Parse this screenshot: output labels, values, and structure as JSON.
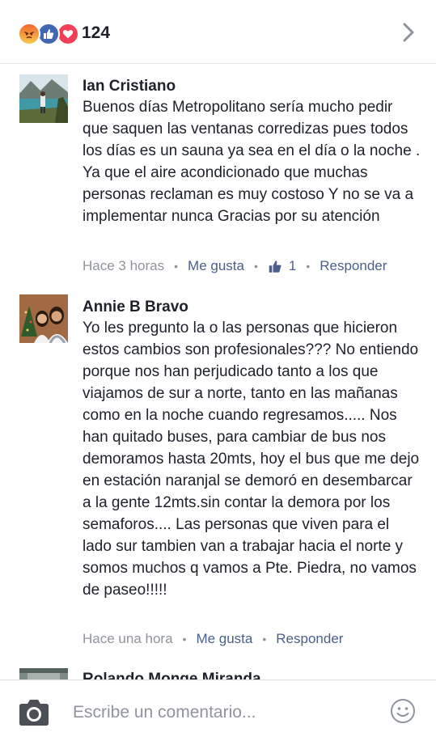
{
  "header": {
    "reaction_icons": [
      "angry-icon",
      "like-icon",
      "love-icon"
    ],
    "reaction_count": "124",
    "reaction_colors": {
      "angry": "#f0662f",
      "like": "#4267b2",
      "love": "#f33e58"
    }
  },
  "comments": [
    {
      "author": "Ian Cristiano",
      "text": "Buenos días Metropolitano sería mucho pedir que saquen las ventanas corredizas pues todos los días es un sauna ya sea en el día o la noche . Ya que el aire acondicionado que muchas personas reclaman es muy costoso Y no se va a implementar nunca Gracias por su atención",
      "time": "Hace 3 horas",
      "like_label": "Me gusta",
      "like_count": "1",
      "reply_label": "Responder"
    },
    {
      "author": "Annie B Bravo",
      "text": "Yo les pregunto la o las personas que hicieron estos cambios son profesionales??? No entiendo porque nos han perjudicado tanto a los que viajamos de sur a norte, tanto en las mañanas como en la noche cuando regresamos..... Nos han quitado buses, para cambiar de bus nos demoramos hasta 20mts, hoy el bus que me dejo en estación naranjal se demoró en desembarcar a la gente 12mts.sin contar la demora por los semaforos.... Las personas que viven para el lado sur tambien van a trabajar hacia el norte y somos muchos q vamos a Pte. Piedra, no vamos de paseo!!!!!",
      "time": "Hace una hora",
      "like_label": "Me gusta",
      "reply_label": "Responder"
    },
    {
      "author": "Rolando Monge Miranda"
    }
  ],
  "composer": {
    "placeholder": "Escribe un comentario..."
  },
  "colors": {
    "link": "#4b5f8c",
    "meta": "#90949c",
    "text": "#1d2129"
  }
}
